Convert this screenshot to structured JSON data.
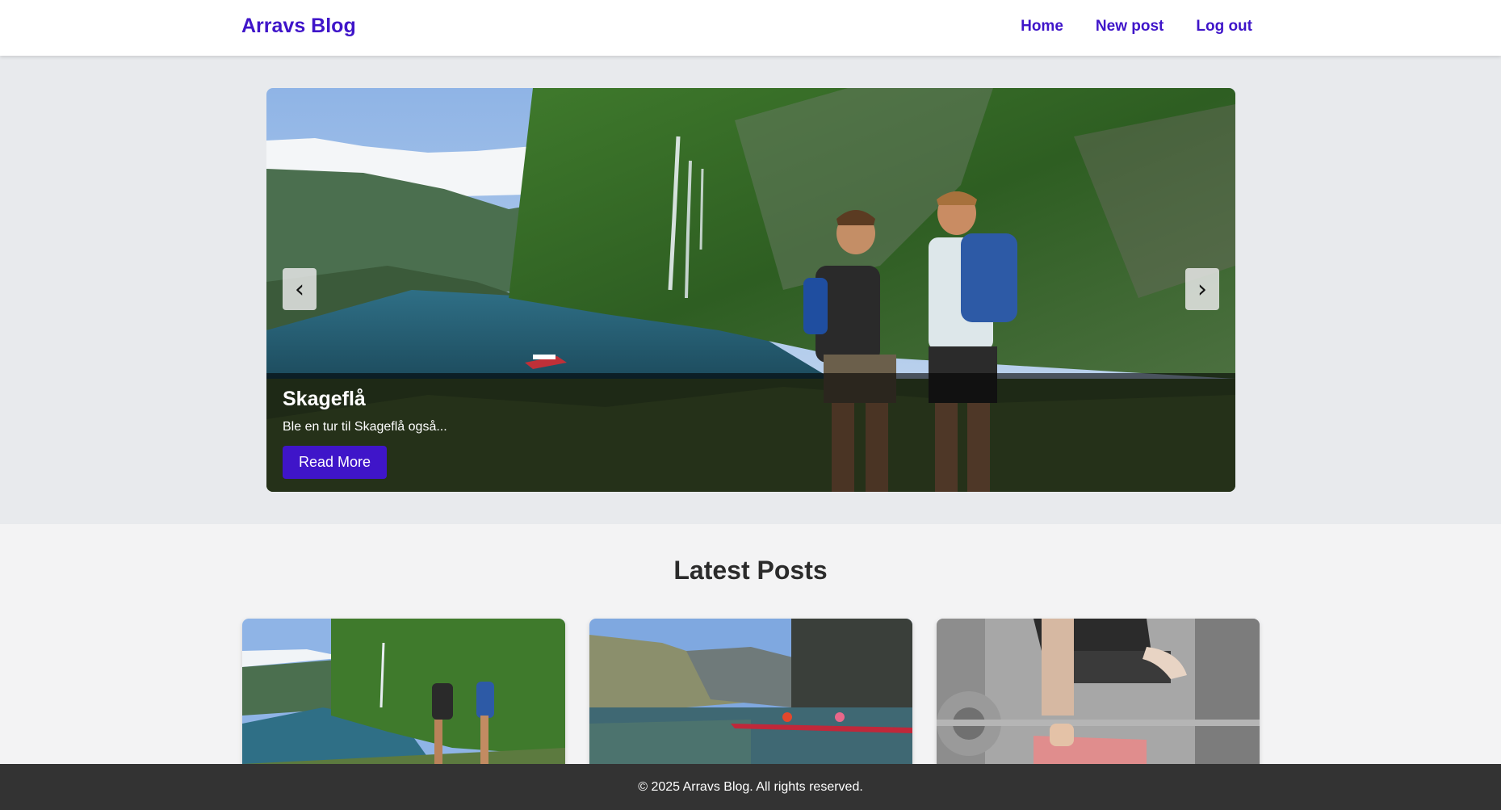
{
  "header": {
    "brand": "Arravs Blog",
    "nav": [
      {
        "label": "Home"
      },
      {
        "label": "New post"
      },
      {
        "label": "Log out"
      }
    ]
  },
  "carousel": {
    "prev_icon": "‹",
    "next_icon": "›",
    "slide": {
      "title": "Skageflå",
      "excerpt": "Ble en tur til Skageflå også...",
      "button_label": "Read More"
    }
  },
  "latest": {
    "heading": "Latest Posts",
    "posts": [
      {
        "image": "fjord-hikers-photo"
      },
      {
        "image": "kayak-fjord-photo"
      },
      {
        "image": "gym-bench-press-photo"
      }
    ]
  },
  "footer": {
    "text": "© 2025 Arravs Blog. All rights reserved."
  },
  "colors": {
    "accent": "#3f15c9",
    "footer_bg": "#333333",
    "hero_band_bg": "#e8eaed"
  }
}
